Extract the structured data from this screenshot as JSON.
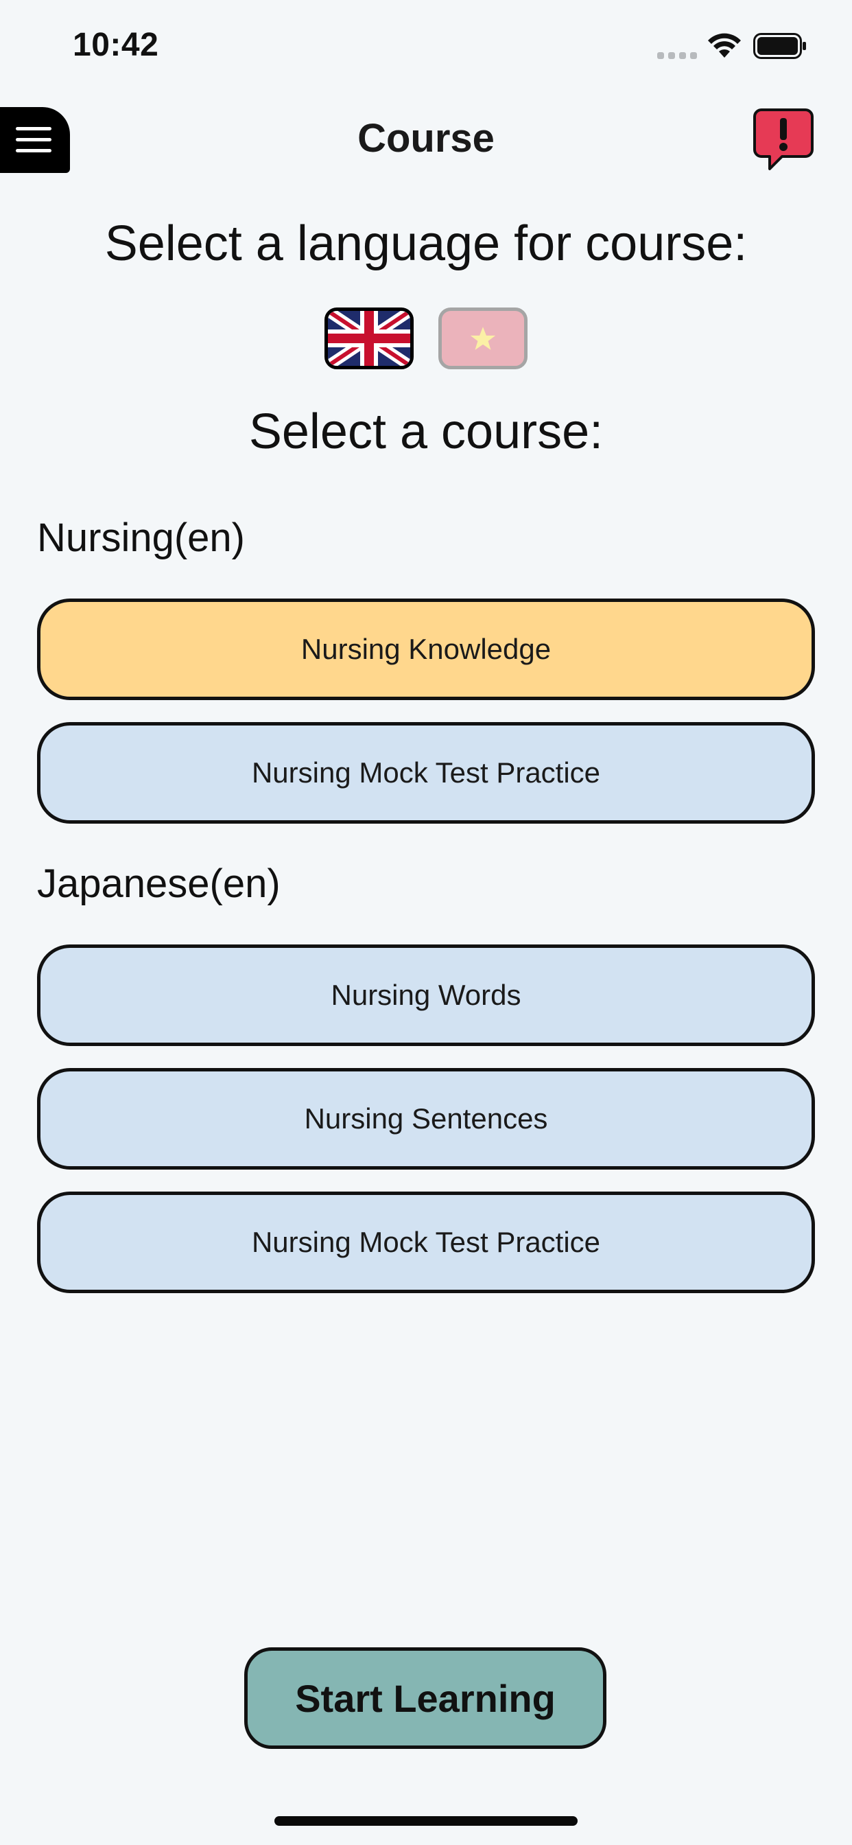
{
  "status_bar": {
    "time": "10:42"
  },
  "nav": {
    "title": "Course"
  },
  "language_heading": "Select a language for course:",
  "languages": [
    {
      "icon": "flag-united-kingdom-icon",
      "selected": true
    },
    {
      "icon": "flag-vietnam-icon",
      "selected": false
    }
  ],
  "course_heading": "Select a course:",
  "sections": [
    {
      "label": "Nursing(en)",
      "courses": [
        {
          "label": "Nursing Knowledge",
          "selected": true
        },
        {
          "label": "Nursing Mock Test Practice",
          "selected": false
        }
      ]
    },
    {
      "label": "Japanese(en)",
      "courses": [
        {
          "label": "Nursing Words",
          "selected": false
        },
        {
          "label": "Nursing Sentences",
          "selected": false
        },
        {
          "label": "Nursing Mock Test Practice",
          "selected": false
        }
      ]
    }
  ],
  "start_button_label": "Start Learning",
  "colors": {
    "background": "#f4f7f9",
    "course_default": "#d2e2f2",
    "course_selected": "#ffd78d",
    "start_button": "#85b6b3",
    "report_icon": "#e63a55"
  }
}
